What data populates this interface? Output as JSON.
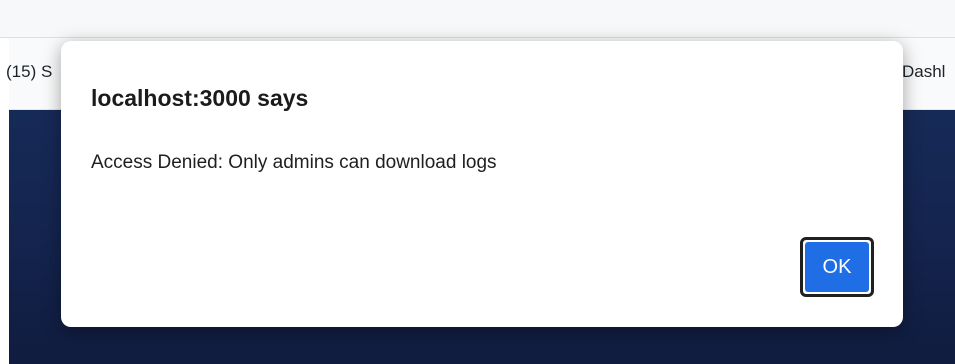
{
  "browser": {
    "bookmarks": [
      {
        "label": "(15) S"
      },
      {
        "label": "Dashl"
      }
    ]
  },
  "dialog": {
    "title": "localhost:3000 says",
    "message": "Access Denied: Only admins can download logs",
    "ok_label": "OK"
  },
  "colors": {
    "page_background": "#14244e",
    "ok_button": "#1f6ee6"
  }
}
